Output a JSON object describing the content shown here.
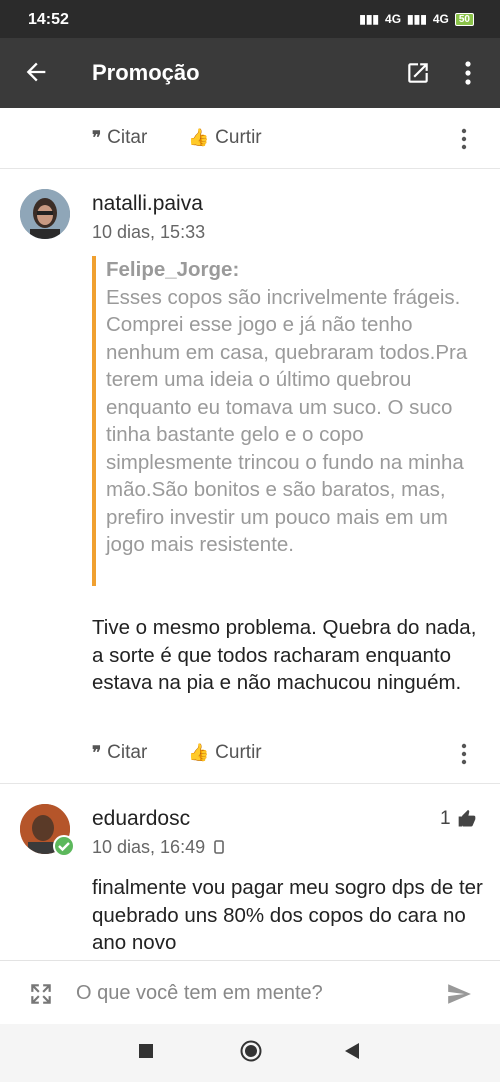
{
  "status_bar": {
    "time": "14:52",
    "network1": "4G",
    "network2": "4G",
    "battery": "50"
  },
  "app_bar": {
    "title": "Promoção",
    "back_icon": "arrow-left-icon",
    "open_icon": "open-external-icon",
    "more_icon": "more-vert-icon"
  },
  "actions": {
    "quote_label": "Citar",
    "like_label": "Curtir",
    "quote_glyph": "❞",
    "like_glyph": "👍"
  },
  "posts": [
    {
      "username": "natalli.paiva",
      "timestamp": "10 dias, 15:33",
      "quote": {
        "author": "Felipe_Jorge:",
        "text": "Esses copos são incrivelmente frágeis. Comprei esse jogo e já não tenho nenhum em casa, quebraram todos.Pra terem uma ideia o último quebrou enquanto eu tomava um suco. O suco tinha bastante gelo e o copo simplesmente trincou o fundo na minha mão.São bonitos e são baratos, mas, prefiro investir um pouco mais em um jogo mais resistente."
      },
      "text": "Tive o mesmo problema. Quebra do nada, a sorte é que todos racharam enquanto estava na pia e não machucou ninguém."
    },
    {
      "username": "eduardosc",
      "timestamp": "10 dias, 16:49",
      "like_count": "1",
      "text": "finalmente vou pagar meu sogro dps de ter quebrado uns 80% dos copos do cara no ano novo"
    }
  ],
  "composer": {
    "placeholder": "O que você tem em mente?",
    "expand_icon": "expand-icon",
    "send_icon": "send-icon"
  },
  "nav_bar": {
    "recents_icon": "square-icon",
    "home_icon": "circle-icon",
    "back_icon": "triangle-back-icon"
  },
  "colors": {
    "quote_border": "#f0a030",
    "appbar": "#3a3a3a",
    "statusbar": "#2b2b2b"
  }
}
